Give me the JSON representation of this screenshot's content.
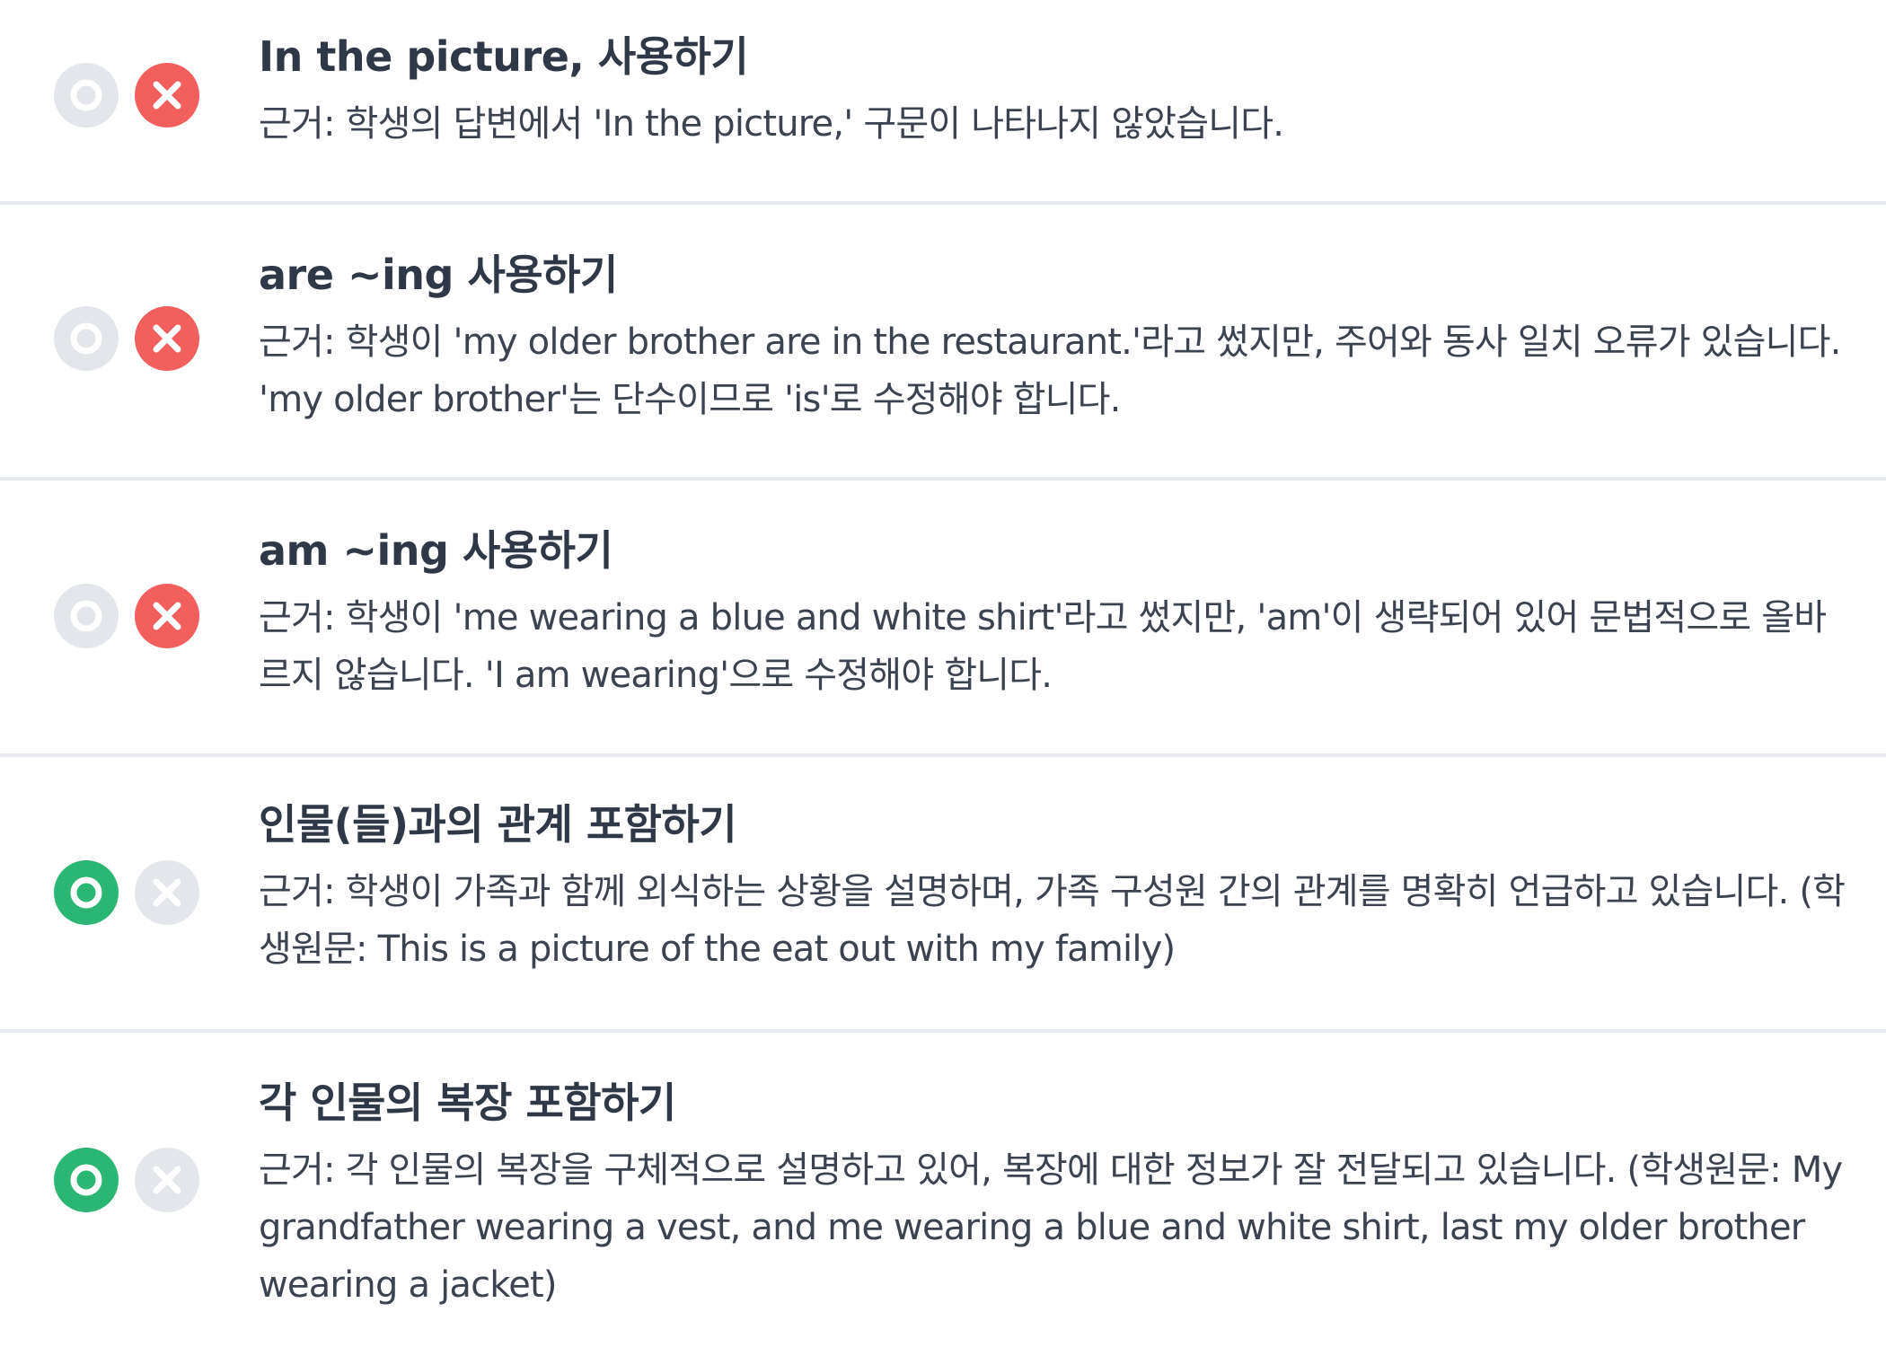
{
  "items": [
    {
      "title": "In the picture, 사용하기",
      "reason": "근거: 학생의 답변에서 'In the picture,' 구문이 나타나지 않았습니다.",
      "o_selected": false,
      "x_selected": true
    },
    {
      "title": "are ~ing 사용하기",
      "reason": "근거: 학생이 'my older brother are in the restaurant.'라고 썼지만, 주어와 동사 일치 오류가 있습니다. 'my older brother'는 단수이므로 'is'로 수정해야 합니다.",
      "o_selected": false,
      "x_selected": true
    },
    {
      "title": "am ~ing 사용하기",
      "reason": "근거: 학생이 'me wearing a blue and white shirt'라고 썼지만, 'am'이 생략되어 있어 문법적으로 올바르지 않습니다. 'I am wearing'으로 수정해야 합니다.",
      "o_selected": false,
      "x_selected": true
    },
    {
      "title": "인물(들)과의 관계 포함하기",
      "reason": "근거: 학생이 가족과 함께 외식하는 상황을 설명하며, 가족 구성원 간의 관계를 명확히 언급하고 있습니다. (학생원문: This is a picture of the eat out with my family)",
      "o_selected": true,
      "x_selected": false
    },
    {
      "title": "각 인물의 복장 포함하기",
      "reason": "근거: 각 인물의 복장을 구체적으로 설명하고 있어, 복장에 대한 정보가 잘 전달되고 있습니다. (학생원문: My grandfather wearing a vest, and me wearing a blue and white shirt, last my older brother wearing a jacket)",
      "o_selected": true,
      "x_selected": false
    }
  ],
  "icons": {
    "o": "circle-o-icon",
    "x": "x-icon"
  },
  "colors": {
    "o_active": "#2bb673",
    "x_active": "#f25f5c",
    "inactive": "#e3e6ea",
    "divider": "#e6e9ee",
    "title": "#2f3846",
    "text": "#3b4350"
  }
}
